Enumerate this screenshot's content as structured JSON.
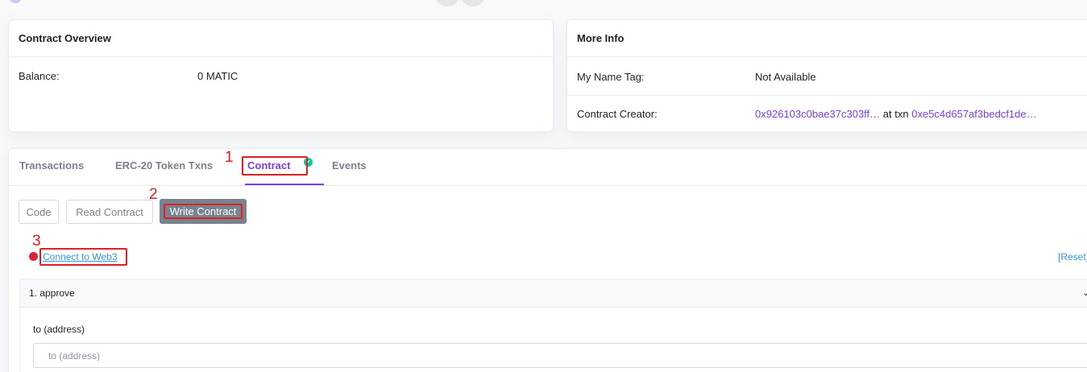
{
  "overview": {
    "title": "Contract Overview",
    "balance_label": "Balance:",
    "balance_value": "0 MATIC"
  },
  "more_info": {
    "title": "More Info",
    "name_tag_label": "My Name Tag:",
    "name_tag_value": "Not Available",
    "creator_label": "Contract Creator:",
    "creator_address": "0x926103c0bae37c303ff…",
    "at_txn": "at txn",
    "creator_txn": "0xe5c4d657af3bedcf1de…"
  },
  "tabs": [
    {
      "label": "Transactions"
    },
    {
      "label": "ERC-20 Token Txns"
    },
    {
      "label": "Contract"
    },
    {
      "label": "Events"
    }
  ],
  "sub_buttons": [
    {
      "label": "Code"
    },
    {
      "label": "Read Contract"
    },
    {
      "label": "Write Contract"
    }
  ],
  "connect": {
    "link_label": "Connect to Web3",
    "reset_label": "[Reset]"
  },
  "function": {
    "title": "1. approve",
    "param_label": "to (address)",
    "param_placeholder": "to (address)"
  },
  "annotations": [
    "1",
    "2",
    "3"
  ],
  "colors": {
    "accent": "#7b3fe4",
    "verified": "#00c9a7",
    "link": "#3498db",
    "annotation": "#e02020",
    "disconnected": "#d9263a"
  }
}
